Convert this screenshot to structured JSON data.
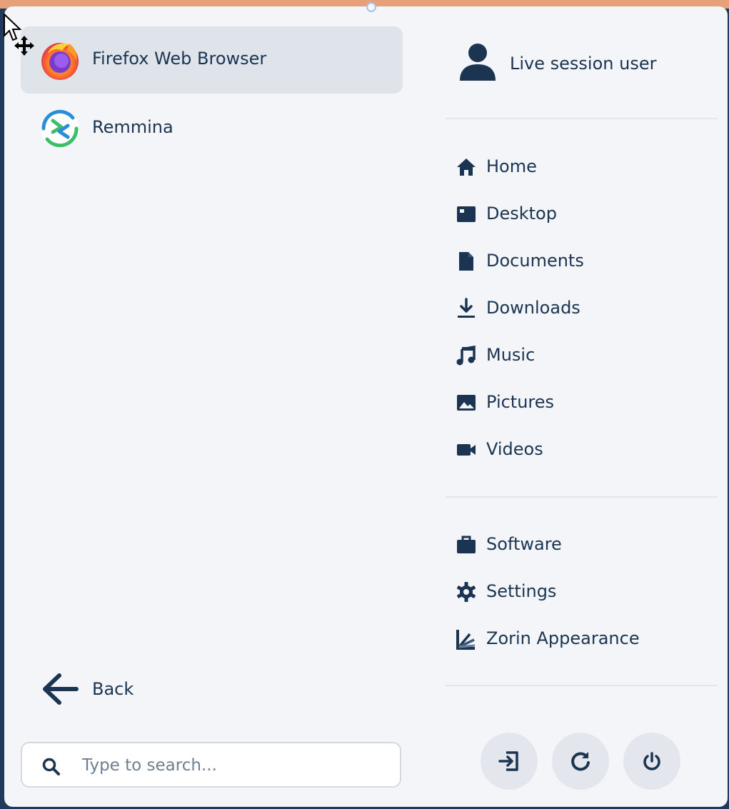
{
  "apps": [
    {
      "name": "Firefox Web Browser",
      "icon": "firefox-icon",
      "selected": true
    },
    {
      "name": "Remmina",
      "icon": "remmina-icon",
      "selected": false
    }
  ],
  "back": {
    "label": "Back",
    "icon": "arrow-left-icon"
  },
  "search": {
    "placeholder": "Type to search...",
    "value": "",
    "icon": "search-icon"
  },
  "user": {
    "name": "Live session user",
    "icon": "user-icon"
  },
  "places": [
    {
      "label": "Home",
      "icon": "home-icon"
    },
    {
      "label": "Desktop",
      "icon": "desktop-icon"
    },
    {
      "label": "Documents",
      "icon": "document-icon"
    },
    {
      "label": "Downloads",
      "icon": "download-icon"
    },
    {
      "label": "Music",
      "icon": "music-icon"
    },
    {
      "label": "Pictures",
      "icon": "image-icon"
    },
    {
      "label": "Videos",
      "icon": "video-icon"
    }
  ],
  "system": [
    {
      "label": "Software",
      "icon": "software-icon"
    },
    {
      "label": "Settings",
      "icon": "gear-icon"
    },
    {
      "label": "Zorin Appearance",
      "icon": "zorin-appearance-icon"
    }
  ],
  "power_buttons": [
    {
      "icon": "logout-icon"
    },
    {
      "icon": "restart-icon"
    },
    {
      "icon": "power-icon"
    }
  ],
  "colors": {
    "accent": "#1b3452",
    "background": "#f3f5f9",
    "selected": "#dfe4eb",
    "top_strip": "#e8a07a"
  }
}
